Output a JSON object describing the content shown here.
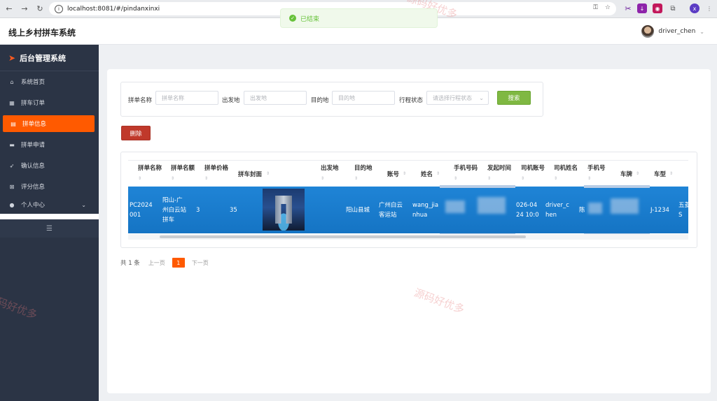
{
  "browser": {
    "url": "localhost:8081/#/pindanxinxi"
  },
  "header": {
    "title": "线上乡村拼车系统",
    "toast": "已结束",
    "username": "driver_chen"
  },
  "sidebar": {
    "title": "后台管理系统",
    "items": [
      {
        "label": "系统首页",
        "icon": "home-icon"
      },
      {
        "label": "拼车订单",
        "icon": "grid-icon"
      },
      {
        "label": "拼单信息",
        "icon": "clipboard-icon"
      },
      {
        "label": "拼单申请",
        "icon": "monitor-icon"
      },
      {
        "label": "确认信息",
        "icon": "send-icon"
      },
      {
        "label": "评分信息",
        "icon": "close-square-icon"
      },
      {
        "label": "个人中心",
        "icon": "user-icon"
      }
    ]
  },
  "search": {
    "name_label": "拼单名称",
    "name_placeholder": "拼单名称",
    "from_label": "出发地",
    "from_placeholder": "出发地",
    "to_label": "目的地",
    "to_placeholder": "目的地",
    "status_label": "行程状态",
    "status_placeholder": "请选择行程状态",
    "search_btn": "搜索"
  },
  "actions": {
    "delete_btn": "删除"
  },
  "table": {
    "columns": [
      "拼单名称",
      "拼单名额",
      "拼单价格",
      "拼车封面",
      "出发地",
      "目的地",
      "账号",
      "姓名",
      "手机号码",
      "发起时间",
      "司机账号",
      "司机姓名",
      "手机号",
      "车牌",
      "车型"
    ],
    "row": {
      "order_no": [
        "PC2024",
        "001"
      ],
      "name": [
        "阳山-广",
        "州白云站",
        "拼车"
      ],
      "seats": "3",
      "price": "35",
      "from": "阳山县城",
      "to": [
        "广州白云",
        "客运站"
      ],
      "account": [
        "wang_jia",
        "nhua"
      ],
      "time": [
        "026-04",
        "24 10:0"
      ],
      "driver_account": [
        "driver_c",
        "hen"
      ],
      "driver_name": "陈",
      "plate": "J-1234",
      "model": [
        "五菱",
        "S"
      ]
    }
  },
  "pager": {
    "total": "共 1 条",
    "prev": "上一页",
    "current": "1",
    "next": "下一页"
  },
  "watermark": "源码好优多"
}
